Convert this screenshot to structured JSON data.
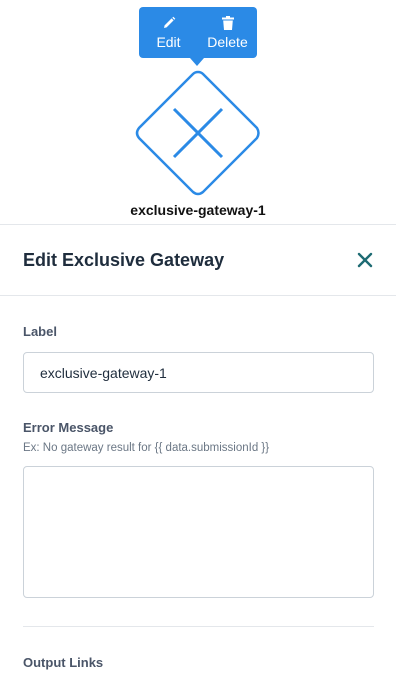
{
  "toolbar": {
    "edit_label": "Edit",
    "delete_label": "Delete",
    "accent_color": "#2b8ae6"
  },
  "node": {
    "label": "exclusive-gateway-1",
    "shape_icon": "exclusive-gateway-icon",
    "stroke_color": "#2b8ae6"
  },
  "panel": {
    "title": "Edit Exclusive Gateway",
    "close_icon": "close-icon",
    "close_color": "#1e6b73"
  },
  "form": {
    "label_field": {
      "label": "Label",
      "value": "exclusive-gateway-1"
    },
    "error_message": {
      "label": "Error Message",
      "hint": "Ex: No gateway result for {{ data.submissionId }}",
      "value": ""
    },
    "output_links": {
      "label": "Output Links"
    }
  }
}
